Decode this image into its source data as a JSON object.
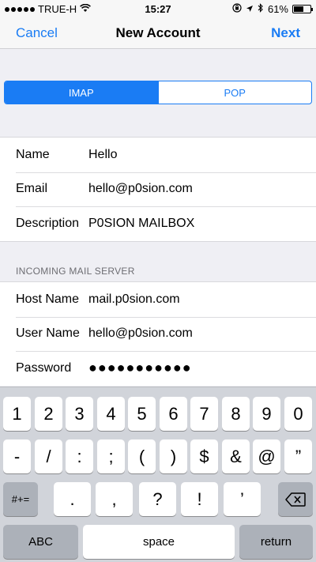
{
  "status": {
    "carrier": "TRUE-H",
    "time": "15:27",
    "battery_text": "61%",
    "battery_level": 0.61,
    "icons": [
      "signal-dots-icon",
      "wifi-icon",
      "orientation-lock-icon",
      "location-icon",
      "bluetooth-icon",
      "battery-icon"
    ]
  },
  "nav": {
    "cancel": "Cancel",
    "title": "New Account",
    "next": "Next"
  },
  "segmented": {
    "options": [
      "IMAP",
      "POP"
    ],
    "selected": "IMAP"
  },
  "account": {
    "name_label": "Name",
    "name_value": "Hello",
    "email_label": "Email",
    "email_value": "hello@p0sion.com",
    "description_label": "Description",
    "description_value": "P0SION MAILBOX"
  },
  "incoming": {
    "header": "INCOMING MAIL SERVER",
    "host_label": "Host Name",
    "host_value": "mail.p0sion.com",
    "user_label": "User Name",
    "user_value": "hello@p0sion.com",
    "password_label": "Password",
    "password_value": "●●●●●●●●●●●"
  },
  "keyboard": {
    "row1": [
      "1",
      "2",
      "3",
      "4",
      "5",
      "6",
      "7",
      "8",
      "9",
      "0"
    ],
    "row2": [
      "-",
      "/",
      ":",
      ";",
      "(",
      ")",
      "$",
      "&",
      "@",
      "”"
    ],
    "row3": [
      ".",
      ",",
      "?",
      "!",
      "’"
    ],
    "symbols_key": "#+=",
    "abc_key": "ABC",
    "space_key": "space",
    "return_key": "return",
    "delete_icon": "backspace-icon"
  },
  "colors": {
    "accent": "#1a7cf4",
    "background": "#efeff4",
    "keyboard_bg": "#d1d4da"
  }
}
